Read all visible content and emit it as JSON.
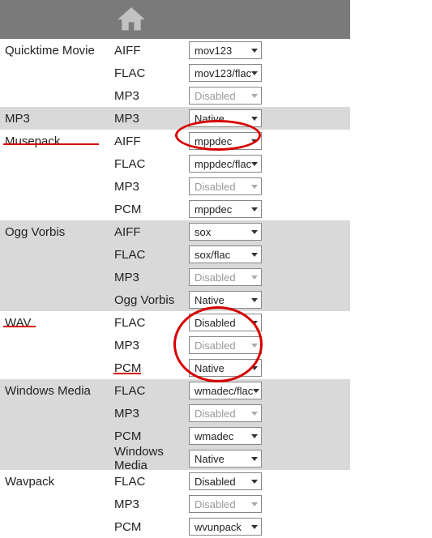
{
  "colors": {
    "accent": "#7a7a7a",
    "highlight": "#d60000",
    "altRow": "#d9d9d9"
  },
  "groups": [
    {
      "format": "Quicktime Movie",
      "alt": false,
      "rows": [
        {
          "codec": "AIFF",
          "value": "mov123",
          "disabled": false
        },
        {
          "codec": "FLAC",
          "value": "mov123/flac",
          "disabled": false
        },
        {
          "codec": "MP3",
          "value": "Disabled",
          "disabled": true
        }
      ]
    },
    {
      "format": "MP3",
      "alt": true,
      "rows": [
        {
          "codec": "MP3",
          "value": "Native",
          "disabled": false
        }
      ]
    },
    {
      "format": "Musepack",
      "alt": false,
      "rows": [
        {
          "codec": "AIFF",
          "value": "mppdec",
          "disabled": false
        },
        {
          "codec": "FLAC",
          "value": "mppdec/flac",
          "disabled": false
        },
        {
          "codec": "MP3",
          "value": "Disabled",
          "disabled": true
        },
        {
          "codec": "PCM",
          "value": "mppdec",
          "disabled": false
        }
      ]
    },
    {
      "format": "Ogg Vorbis",
      "alt": true,
      "rows": [
        {
          "codec": "AIFF",
          "value": "sox",
          "disabled": false
        },
        {
          "codec": "FLAC",
          "value": "sox/flac",
          "disabled": false
        },
        {
          "codec": "MP3",
          "value": "Disabled",
          "disabled": true
        },
        {
          "codec": "Ogg Vorbis",
          "value": "Native",
          "disabled": false
        }
      ]
    },
    {
      "format": "WAV",
      "alt": false,
      "rows": [
        {
          "codec": "FLAC",
          "value": "Disabled",
          "disabled": false
        },
        {
          "codec": "MP3",
          "value": "Disabled",
          "disabled": true
        },
        {
          "codec": "PCM",
          "value": "Native",
          "disabled": false
        }
      ]
    },
    {
      "format": "Windows Media",
      "alt": true,
      "rows": [
        {
          "codec": "FLAC",
          "value": "wmadec/flac",
          "disabled": false
        },
        {
          "codec": "MP3",
          "value": "Disabled",
          "disabled": true
        },
        {
          "codec": "PCM",
          "value": "wmadec",
          "disabled": false
        },
        {
          "codec": "Windows Media",
          "value": "Native",
          "disabled": false
        }
      ]
    },
    {
      "format": "Wavpack",
      "alt": false,
      "rows": [
        {
          "codec": "FLAC",
          "value": "Disabled",
          "disabled": false
        },
        {
          "codec": "MP3",
          "value": "Disabled",
          "disabled": true
        },
        {
          "codec": "PCM",
          "value": "wvunpack",
          "disabled": false
        }
      ]
    }
  ]
}
